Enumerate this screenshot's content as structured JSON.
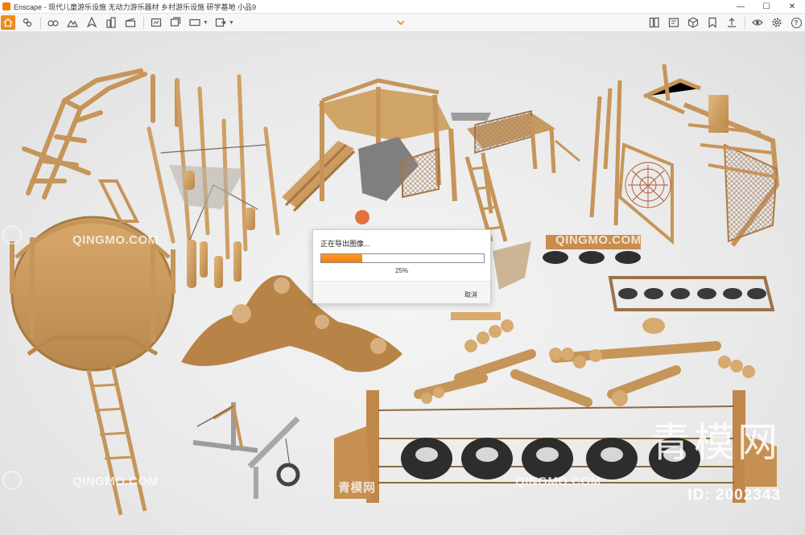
{
  "window": {
    "title": "Enscape - 现代儿童游乐设施 无动力游乐器材 乡村游乐设施 研学基地 小品9",
    "minimize_symbol": "—",
    "maximize_symbol": "☐",
    "close_symbol": "✕"
  },
  "toolbar": {
    "home_icon": "home-icon",
    "left_icons": [
      "settings-sliders-icon",
      "binoculars-icon",
      "mountain-icon",
      "compass-icon",
      "city-icon",
      "clapper-icon",
      "screenshot-icon",
      "batch-render-icon",
      "panorama-icon",
      "export-icon"
    ],
    "right_icons": [
      "asset-library-icon",
      "material-editor-icon",
      "cube-icon",
      "bookmark-icon",
      "uploads-icon",
      "eye-icon",
      "gear-icon",
      "help-icon"
    ],
    "help_label": "?",
    "accent": "#f08a1c"
  },
  "viewport": {
    "watermark_text": "QINGMO.COM",
    "watermark_cn": "青模网",
    "brand_text": "青模网",
    "id_text": "ID: 2002343",
    "background": "#ececec"
  },
  "progress_dialog": {
    "title": "正在导出图像...",
    "progress": 0.25,
    "percent_label": "25%",
    "cancel_label": "取消",
    "bar_color": "#f37b06"
  }
}
